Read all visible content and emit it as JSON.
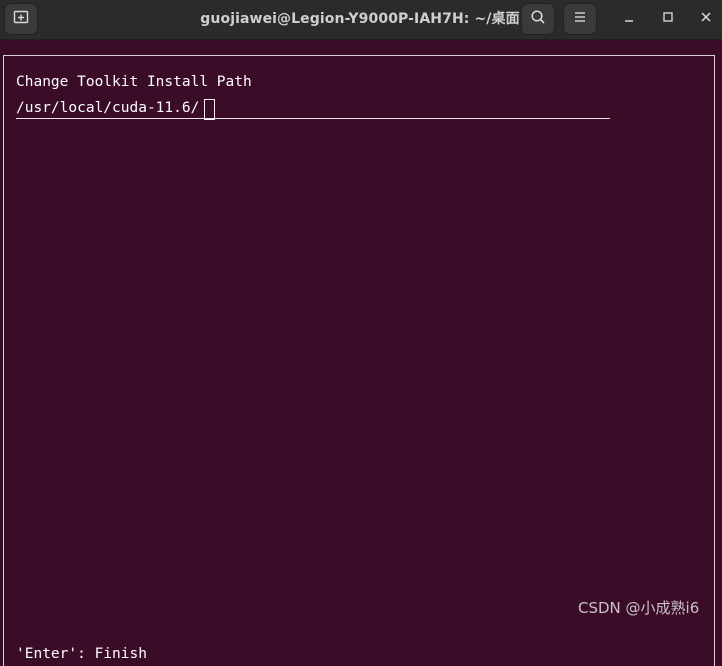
{
  "window": {
    "title": "guojiawei@Legion-Y9000P-IAH7H: ~/桌面"
  },
  "titlebar": {
    "new_tab_icon": "new-tab-icon",
    "search_icon": "search-icon",
    "menu_icon": "hamburger-menu-icon",
    "minimize_icon": "minimize-icon",
    "maximize_icon": "maximize-icon",
    "close_icon": "close-icon"
  },
  "dialog": {
    "title": "Change Toolkit Install Path",
    "path_value": "/usr/local/cuda-11.6/",
    "footer_hint": "'Enter': Finish"
  },
  "watermark": "CSDN @小成熟i6",
  "colors": {
    "terminal_bg": "#3a0c27",
    "titlebar_bg": "#2b2b2b",
    "text": "#ffffff"
  }
}
